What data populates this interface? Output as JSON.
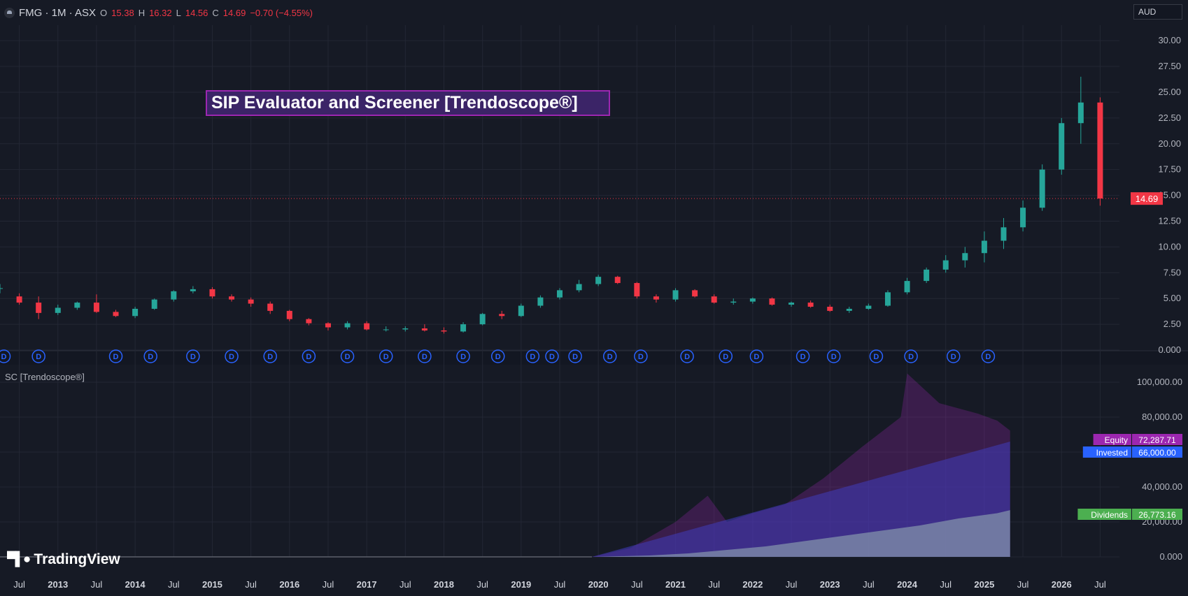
{
  "header": {
    "symbol": "FMG · 1M · ASX",
    "open_label": "O",
    "open": "15.38",
    "high_label": "H",
    "high": "16.32",
    "low_label": "L",
    "low": "14.56",
    "close_label": "C",
    "close": "14.69",
    "change": "−0.70 (−4.55%)"
  },
  "currency": "AUD",
  "overlay_title": "SIP Evaluator and Screener [Trendoscope®]",
  "indicator_label": "SC [Trendoscope®]",
  "brand": "TradingView",
  "colors": {
    "up": "#26a69a",
    "down": "#f23645",
    "background": "#161a25",
    "equity": "#9c27b0",
    "invested": "#2962ff",
    "dividends": "#4caf50"
  },
  "price_axis": {
    "ticks": [
      "30.00",
      "27.50",
      "25.00",
      "22.50",
      "20.00",
      "17.50",
      "15.00",
      "12.50",
      "10.00",
      "7.50",
      "5.00",
      "2.50",
      "0.000"
    ],
    "last_price": "14.69"
  },
  "lower_axis": {
    "ticks": [
      "100,000.00",
      "80,000.00",
      "60,000.00",
      "40,000.00",
      "20,000.00",
      "0.000"
    ]
  },
  "time_axis": {
    "labels": [
      "Jul",
      "2013",
      "Jul",
      "2014",
      "Jul",
      "2015",
      "Jul",
      "2016",
      "Jul",
      "2017",
      "Jul",
      "2018",
      "Jul",
      "2019",
      "Jul",
      "2020",
      "Jul",
      "2021",
      "Jul",
      "2022",
      "Jul",
      "2023",
      "Jul",
      "2024",
      "Jul",
      "2025",
      "Jul",
      "2026",
      "Jul"
    ]
  },
  "dividend_marker": "D",
  "legend": [
    {
      "name": "Equity",
      "value": "72,287.71",
      "color": "#9c27b0"
    },
    {
      "name": "Invested",
      "value": "66,000.00",
      "color": "#2962ff"
    },
    {
      "name": "Dividends",
      "value": "26,773.16",
      "color": "#4caf50"
    }
  ],
  "chart_data": [
    {
      "type": "candlestick",
      "title": "FMG · 1M · ASX",
      "ylim": [
        0,
        31.5
      ],
      "y_ticks": [
        0,
        2.5,
        5,
        7.5,
        10,
        12.5,
        15,
        17.5,
        20,
        22.5,
        25,
        27.5,
        30
      ],
      "x_start": "2012-04",
      "x_end": "2026-09",
      "last_price": 14.69,
      "candles": [
        {
          "t": "2012-04",
          "o": 6.0,
          "h": 6.4,
          "l": 5.5,
          "c": 6.0
        },
        {
          "t": "2012-07",
          "o": 5.2,
          "h": 5.5,
          "l": 4.4,
          "c": 4.6
        },
        {
          "t": "2012-10",
          "o": 4.6,
          "h": 5.2,
          "l": 3.0,
          "c": 3.6
        },
        {
          "t": "2013-01",
          "o": 3.6,
          "h": 4.4,
          "l": 3.4,
          "c": 4.1
        },
        {
          "t": "2013-04",
          "o": 4.1,
          "h": 4.7,
          "l": 3.9,
          "c": 4.6
        },
        {
          "t": "2013-07",
          "o": 4.6,
          "h": 5.4,
          "l": 3.6,
          "c": 3.7
        },
        {
          "t": "2013-10",
          "o": 3.7,
          "h": 3.9,
          "l": 3.2,
          "c": 3.3
        },
        {
          "t": "2014-01",
          "o": 3.3,
          "h": 4.2,
          "l": 3.1,
          "c": 4.0
        },
        {
          "t": "2014-04",
          "o": 4.0,
          "h": 5.0,
          "l": 3.9,
          "c": 4.9
        },
        {
          "t": "2014-07",
          "o": 4.9,
          "h": 5.8,
          "l": 4.7,
          "c": 5.7
        },
        {
          "t": "2014-10",
          "o": 5.7,
          "h": 6.2,
          "l": 5.5,
          "c": 5.9
        },
        {
          "t": "2015-01",
          "o": 5.9,
          "h": 6.1,
          "l": 5.0,
          "c": 5.2
        },
        {
          "t": "2015-04",
          "o": 5.2,
          "h": 5.4,
          "l": 4.7,
          "c": 4.9
        },
        {
          "t": "2015-07",
          "o": 4.9,
          "h": 5.1,
          "l": 4.2,
          "c": 4.5
        },
        {
          "t": "2015-10",
          "o": 4.5,
          "h": 4.7,
          "l": 3.5,
          "c": 3.8
        },
        {
          "t": "2016-01",
          "o": 3.8,
          "h": 3.9,
          "l": 2.8,
          "c": 3.0
        },
        {
          "t": "2016-04",
          "o": 3.0,
          "h": 3.1,
          "l": 2.4,
          "c": 2.6
        },
        {
          "t": "2016-07",
          "o": 2.6,
          "h": 2.7,
          "l": 1.9,
          "c": 2.2
        },
        {
          "t": "2016-10",
          "o": 2.2,
          "h": 2.8,
          "l": 2.0,
          "c": 2.6
        },
        {
          "t": "2017-01",
          "o": 2.6,
          "h": 2.8,
          "l": 1.9,
          "c": 2.0
        },
        {
          "t": "2017-04",
          "o": 2.0,
          "h": 2.3,
          "l": 1.8,
          "c": 2.0
        },
        {
          "t": "2017-07",
          "o": 2.0,
          "h": 2.3,
          "l": 1.8,
          "c": 2.1
        },
        {
          "t": "2017-10",
          "o": 2.1,
          "h": 2.5,
          "l": 1.8,
          "c": 1.9
        },
        {
          "t": "2018-01",
          "o": 1.9,
          "h": 2.2,
          "l": 1.6,
          "c": 1.8
        },
        {
          "t": "2018-04",
          "o": 1.8,
          "h": 2.7,
          "l": 1.7,
          "c": 2.5
        },
        {
          "t": "2018-07",
          "o": 2.5,
          "h": 3.6,
          "l": 2.4,
          "c": 3.5
        },
        {
          "t": "2018-10",
          "o": 3.5,
          "h": 3.8,
          "l": 3.0,
          "c": 3.3
        },
        {
          "t": "2019-01",
          "o": 3.3,
          "h": 4.5,
          "l": 3.2,
          "c": 4.3
        },
        {
          "t": "2019-04",
          "o": 4.3,
          "h": 5.3,
          "l": 4.1,
          "c": 5.1
        },
        {
          "t": "2019-07",
          "o": 5.1,
          "h": 6.0,
          "l": 4.9,
          "c": 5.8
        },
        {
          "t": "2019-10",
          "o": 5.8,
          "h": 6.8,
          "l": 5.6,
          "c": 6.4
        },
        {
          "t": "2020-01",
          "o": 6.4,
          "h": 7.3,
          "l": 6.2,
          "c": 7.1
        },
        {
          "t": "2020-04",
          "o": 7.1,
          "h": 7.2,
          "l": 6.4,
          "c": 6.5
        },
        {
          "t": "2020-07",
          "o": 6.5,
          "h": 6.6,
          "l": 5.0,
          "c": 5.2
        },
        {
          "t": "2020-10",
          "o": 5.2,
          "h": 5.4,
          "l": 4.6,
          "c": 4.9
        },
        {
          "t": "2021-01",
          "o": 4.9,
          "h": 6.0,
          "l": 4.7,
          "c": 5.8
        },
        {
          "t": "2021-04",
          "o": 5.8,
          "h": 5.9,
          "l": 5.1,
          "c": 5.2
        },
        {
          "t": "2021-07",
          "o": 5.2,
          "h": 5.4,
          "l": 4.5,
          "c": 4.6
        },
        {
          "t": "2021-10",
          "o": 4.6,
          "h": 5.0,
          "l": 4.4,
          "c": 4.7
        },
        {
          "t": "2022-01",
          "o": 4.7,
          "h": 5.1,
          "l": 4.5,
          "c": 5.0
        },
        {
          "t": "2022-04",
          "o": 5.0,
          "h": 5.1,
          "l": 4.3,
          "c": 4.4
        },
        {
          "t": "2022-07",
          "o": 4.4,
          "h": 4.7,
          "l": 4.2,
          "c": 4.6
        },
        {
          "t": "2022-10",
          "o": 4.6,
          "h": 4.8,
          "l": 4.1,
          "c": 4.2
        },
        {
          "t": "2023-01",
          "o": 4.2,
          "h": 4.4,
          "l": 3.7,
          "c": 3.8
        },
        {
          "t": "2023-04",
          "o": 3.8,
          "h": 4.2,
          "l": 3.6,
          "c": 4.0
        },
        {
          "t": "2023-07",
          "o": 4.0,
          "h": 4.5,
          "l": 3.9,
          "c": 4.3
        },
        {
          "t": "2023-10",
          "o": 4.3,
          "h": 5.8,
          "l": 4.2,
          "c": 5.6
        },
        {
          "t": "2024-01",
          "o": 5.6,
          "h": 7.0,
          "l": 5.4,
          "c": 6.7
        },
        {
          "t": "2024-04",
          "o": 6.7,
          "h": 8.0,
          "l": 6.5,
          "c": 7.8
        },
        {
          "t": "2024-07",
          "o": 7.8,
          "h": 9.2,
          "l": 7.5,
          "c": 8.7
        },
        {
          "t": "2024-10",
          "o": 8.7,
          "h": 10.0,
          "l": 8.0,
          "c": 9.4
        },
        {
          "t": "2025-01",
          "o": 9.4,
          "h": 11.5,
          "l": 8.5,
          "c": 10.6
        },
        {
          "t": "2025-04",
          "o": 10.6,
          "h": 12.8,
          "l": 9.8,
          "c": 11.9
        },
        {
          "t": "2025-07",
          "o": 11.9,
          "h": 14.5,
          "l": 11.5,
          "c": 13.8
        },
        {
          "t": "2025-10",
          "o": 13.8,
          "h": 18.0,
          "l": 13.5,
          "c": 17.5
        },
        {
          "t": "2026-01",
          "o": 17.5,
          "h": 22.5,
          "l": 17.0,
          "c": 22.0
        },
        {
          "t": "2026-04",
          "o": 22.0,
          "h": 26.5,
          "l": 20.0,
          "c": 24.0
        },
        {
          "t": "2026-07",
          "o": 24.0,
          "h": 24.5,
          "l": 14.0,
          "c": 14.69
        }
      ]
    },
    {
      "type": "area",
      "title": "SC [Trendoscope®]",
      "ylim": [
        0,
        110000
      ],
      "y_ticks": [
        0,
        20000,
        40000,
        60000,
        80000,
        100000
      ],
      "x_start": "2012-04",
      "x_end": "2026-09",
      "series": [
        {
          "name": "Equity",
          "x": [
            "2019-12",
            "2020-06",
            "2021-01",
            "2021-06",
            "2021-09",
            "2022-01",
            "2022-06",
            "2022-12",
            "2023-06",
            "2023-12",
            "2024-01",
            "2024-06",
            "2024-12",
            "2025-03",
            "2025-05"
          ],
          "values": [
            0,
            5000,
            20000,
            35000,
            20000,
            25000,
            30000,
            45000,
            63000,
            80000,
            105000,
            88000,
            82000,
            78000,
            72287.71
          ]
        },
        {
          "name": "Invested",
          "x": [
            "2019-12",
            "2025-05"
          ],
          "values": [
            0,
            66000
          ]
        },
        {
          "name": "Dividends",
          "x": [
            "2019-12",
            "2020-09",
            "2021-03",
            "2021-09",
            "2022-03",
            "2022-09",
            "2023-03",
            "2023-09",
            "2024-03",
            "2024-09",
            "2025-03",
            "2025-05"
          ],
          "values": [
            0,
            800,
            2000,
            4000,
            6000,
            9000,
            12000,
            15000,
            18000,
            22000,
            25000,
            26773.16
          ]
        }
      ]
    }
  ]
}
